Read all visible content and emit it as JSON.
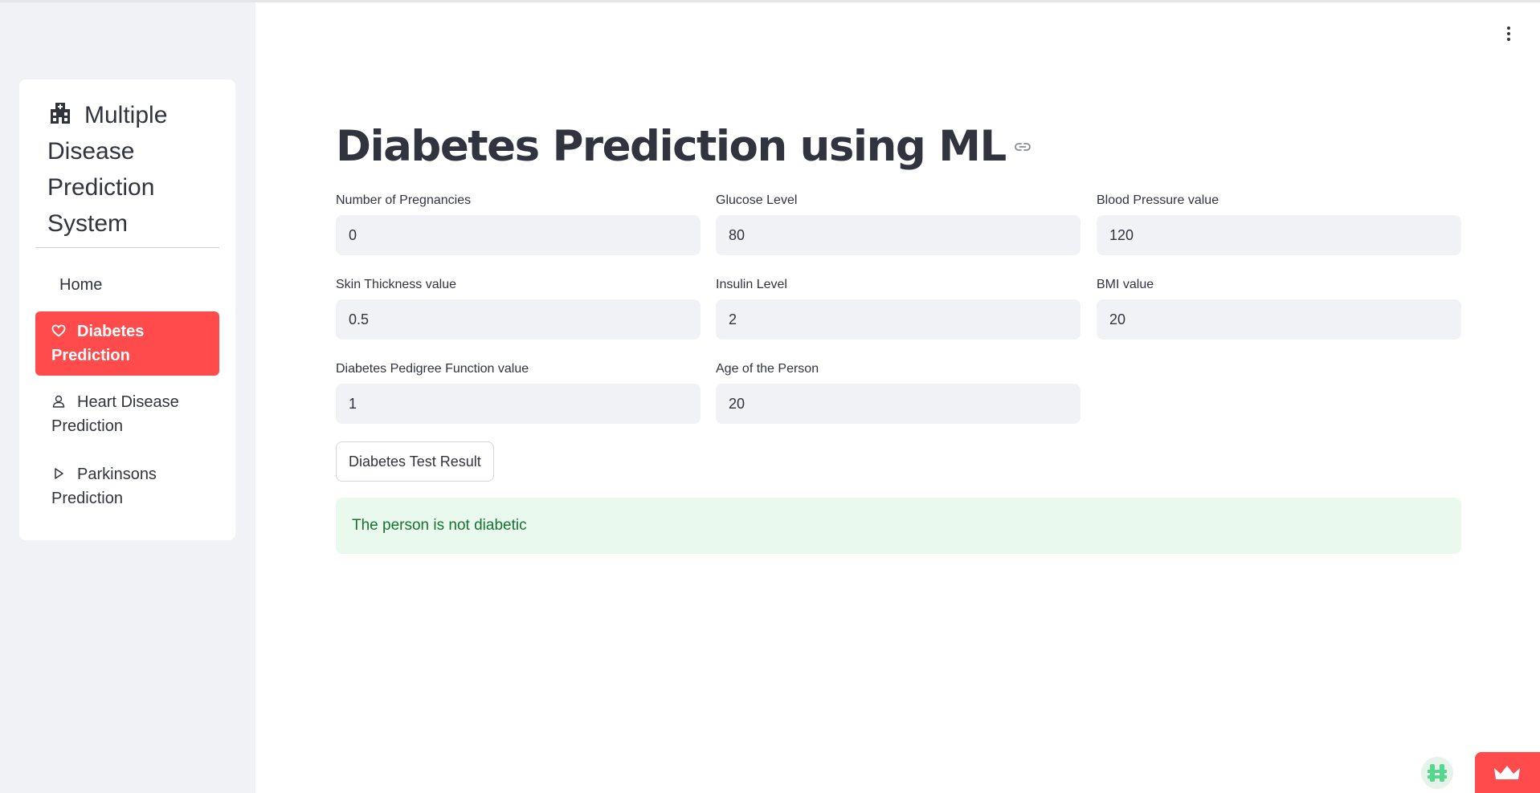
{
  "sidebar": {
    "title": "Multiple Disease Prediction System",
    "title_icon": "hospital-icon",
    "items": [
      {
        "label": "Home",
        "icon": "",
        "active": false
      },
      {
        "label": "Diabetes Prediction",
        "icon": "heart-icon",
        "active": true
      },
      {
        "label": "Heart Disease Prediction",
        "icon": "person-icon",
        "active": false
      },
      {
        "label": "Parkinsons Prediction",
        "icon": "play-icon",
        "active": false
      }
    ]
  },
  "main": {
    "title": "Diabetes Prediction using ML",
    "fields": [
      {
        "label": "Number of Pregnancies",
        "value": "0"
      },
      {
        "label": "Glucose Level",
        "value": "80"
      },
      {
        "label": "Blood Pressure value",
        "value": "120"
      },
      {
        "label": "Skin Thickness value",
        "value": "0.5"
      },
      {
        "label": "Insulin Level",
        "value": "2"
      },
      {
        "label": "BMI value",
        "value": "20"
      },
      {
        "label": "Diabetes Pedigree Function value",
        "value": "1"
      },
      {
        "label": "Age of the Person",
        "value": "20"
      }
    ],
    "button_label": "Diabetes Test Result",
    "result_text": "The person is not diabetic"
  },
  "colors": {
    "accent": "#ff4b4b",
    "success_bg": "#e9f9ee",
    "success_text": "#177233",
    "sidebar_bg": "#f0f2f6"
  }
}
